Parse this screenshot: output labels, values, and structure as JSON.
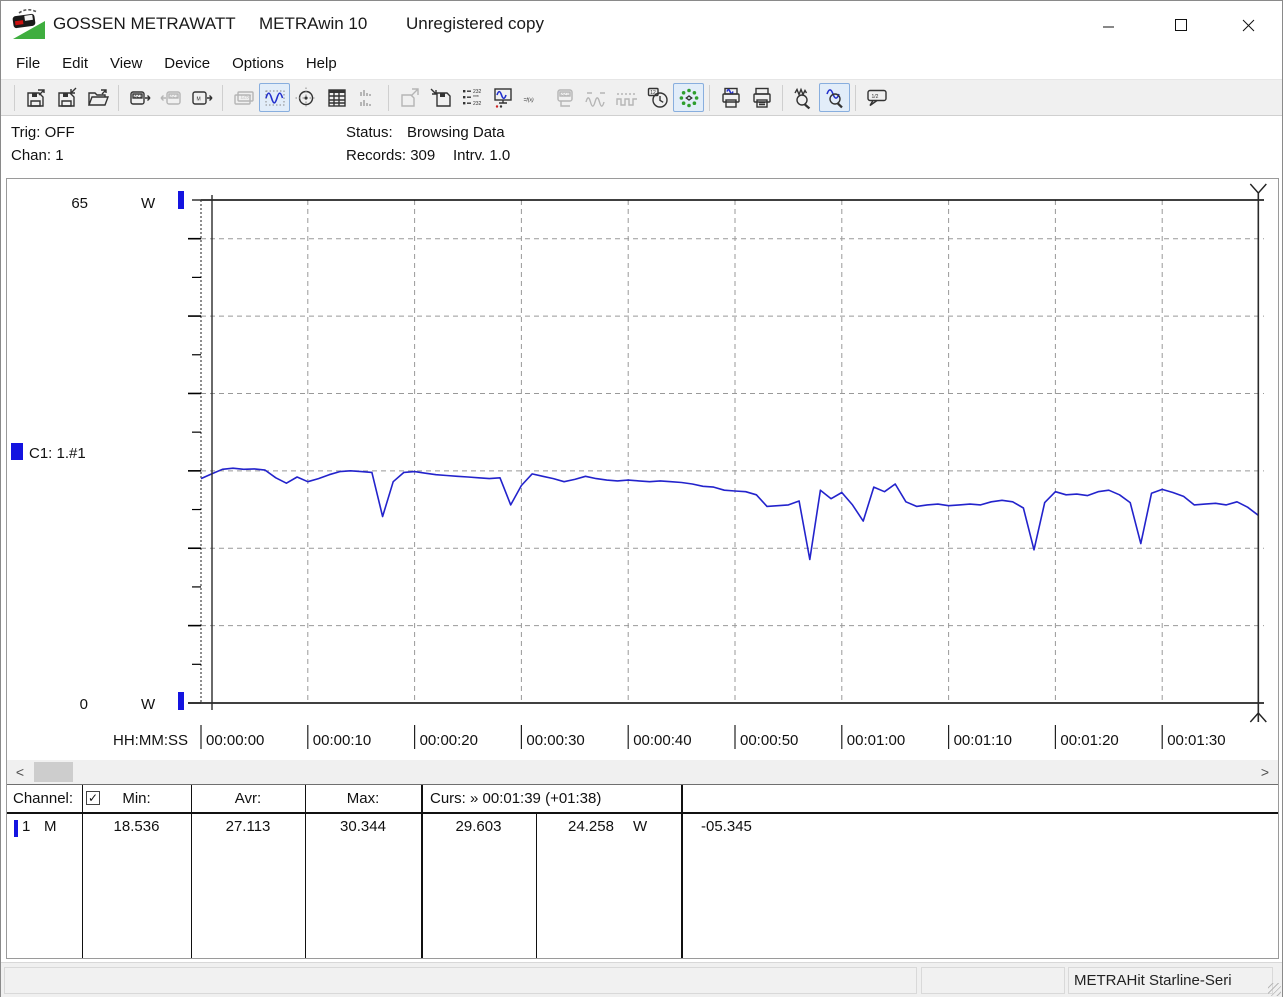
{
  "window": {
    "title_app": "GOSSEN METRAWATT",
    "title_product": "METRAwin 10",
    "title_status": "Unregistered copy"
  },
  "menu": {
    "items": [
      "File",
      "Edit",
      "View",
      "Device",
      "Options",
      "Help"
    ]
  },
  "toolbar": {
    "groups": [
      [
        {
          "name": "save-file"
        },
        {
          "name": "save-as"
        },
        {
          "name": "open-file"
        }
      ],
      [
        {
          "name": "read-device-memory"
        },
        {
          "name": "write-device",
          "disabled": true
        },
        {
          "name": "read-device-m"
        }
      ],
      [
        {
          "name": "multimeter-display",
          "disabled": true
        },
        {
          "name": "chart-view",
          "pressed": true
        },
        {
          "name": "xy-view"
        },
        {
          "name": "table-view"
        },
        {
          "name": "histogram-view",
          "disabled": true
        }
      ],
      [
        {
          "name": "export-data",
          "disabled": true
        },
        {
          "name": "store-to-file"
        },
        {
          "name": "channel-config"
        },
        {
          "name": "online-display"
        },
        {
          "name": "formula"
        },
        {
          "name": "device-settings",
          "disabled": true
        },
        {
          "name": "analog-output",
          "disabled": true
        },
        {
          "name": "pulse-output",
          "disabled": true
        },
        {
          "name": "time-settings"
        },
        {
          "name": "live-record",
          "pressed": true
        }
      ],
      [
        {
          "name": "print-chart"
        },
        {
          "name": "print"
        }
      ],
      [
        {
          "name": "zoom-search"
        },
        {
          "name": "zoom-mode",
          "pressed": true
        }
      ],
      [
        {
          "name": "value-tooltip"
        }
      ]
    ]
  },
  "info": {
    "trig": "Trig: OFF",
    "chan": "Chan:  1",
    "status_label": "Status:",
    "status_value": "Browsing Data",
    "records": "Records: 309",
    "interval": "Intrv. 1.0"
  },
  "chart": {
    "y_max_label": "65",
    "y_min_label": "0",
    "unit": "W",
    "channel_label": "C1: 1.#1",
    "x_axis_label": "HH:MM:SS",
    "colors": {
      "line": "#2323cc",
      "marker": "#1414e0",
      "grid": "#999999",
      "axis": "#000000",
      "cursor": "#2a2a2a"
    }
  },
  "chart_data": {
    "type": "line",
    "title": "",
    "xlabel": "HH:MM:SS",
    "ylabel": "W",
    "ylim": [
      0,
      65
    ],
    "y_tick_step": 5,
    "y_gridline_step": 10,
    "x_range_seconds": [
      0,
      99
    ],
    "interval_seconds": 1,
    "x_ticks": [
      "00:00:00",
      "00:00:10",
      "00:00:20",
      "00:00:30",
      "00:00:40",
      "00:00:50",
      "00:01:00",
      "00:01:10",
      "00:01:20",
      "00:01:30"
    ],
    "x_tick_seconds": [
      0,
      10,
      20,
      30,
      40,
      50,
      60,
      70,
      80,
      90
    ],
    "grid": true,
    "legend_position": "left",
    "series": [
      {
        "name": "C1: 1.#1",
        "unit": "W",
        "color": "#2323cc",
        "values": [
          29.0,
          29.6,
          30.2,
          30.34,
          30.2,
          30.25,
          30.1,
          29.1,
          28.4,
          29.2,
          28.6,
          29.0,
          29.5,
          29.9,
          30.0,
          29.9,
          29.8,
          24.1,
          28.6,
          29.8,
          29.9,
          29.7,
          29.5,
          29.4,
          29.3,
          29.2,
          29.1,
          29.0,
          29.1,
          25.6,
          28.1,
          29.6,
          29.3,
          29.0,
          28.6,
          28.9,
          29.3,
          29.0,
          28.8,
          28.7,
          28.8,
          28.7,
          28.6,
          28.7,
          28.6,
          28.5,
          28.3,
          28.0,
          27.9,
          27.5,
          27.4,
          27.3,
          26.9,
          25.4,
          25.5,
          25.6,
          26.1,
          18.54,
          27.5,
          26.4,
          27.2,
          25.6,
          23.5,
          27.9,
          27.3,
          28.3,
          26.0,
          25.4,
          25.6,
          25.7,
          25.5,
          25.6,
          25.7,
          25.6,
          26.0,
          26.2,
          26.0,
          25.2,
          19.8,
          25.9,
          27.3,
          26.9,
          27.0,
          26.8,
          27.3,
          27.5,
          26.9,
          25.9,
          20.6,
          27.1,
          27.6,
          27.2,
          26.7,
          25.6,
          25.7,
          25.8,
          25.6,
          26.0,
          25.3,
          24.26
        ]
      }
    ],
    "cursors": {
      "left_time": "00:00:01",
      "right_time": "00:01:39",
      "right_value": 24.258
    },
    "stats": {
      "min": 18.536,
      "avg": 27.113,
      "max": 30.344,
      "cursor1_value": 29.603,
      "cursor2_value": 24.258,
      "delta": -5.345
    }
  },
  "values_panel": {
    "headers": {
      "channel": "Channel:",
      "min": "Min:",
      "avr": "Avr:",
      "max": "Max:",
      "cursor": "Curs: » 00:01:39 (+01:38)"
    },
    "checkbox_checked": true,
    "row": {
      "channel_no": "1",
      "channel_mode": "M",
      "min": "18.536",
      "avr": "27.113",
      "max": "30.344",
      "cursor1": "29.603",
      "cursor2": "24.258",
      "unit": "W",
      "delta": "-05.345"
    }
  },
  "statusbar": {
    "device": "METRAHit Starline-Seri"
  }
}
